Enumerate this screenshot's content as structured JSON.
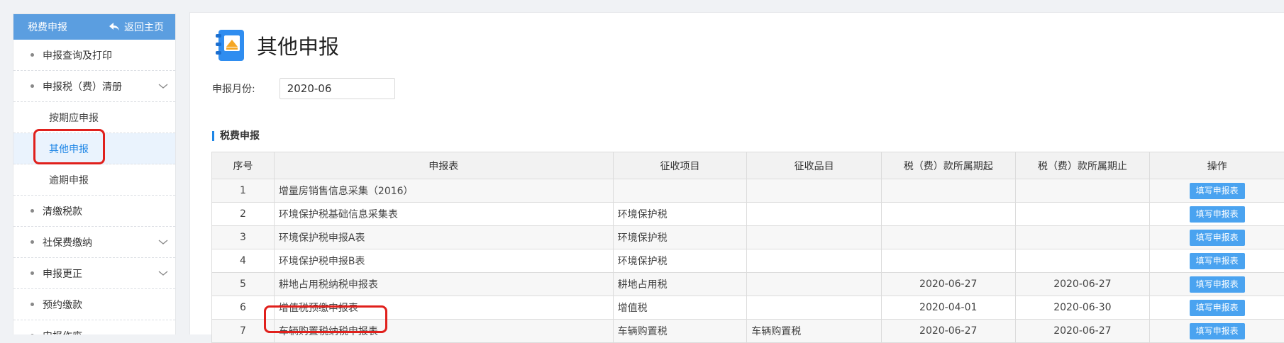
{
  "sidebar": {
    "header_title": "税费申报",
    "back_label": "返回主页",
    "items": [
      {
        "label": "申报查询及打印"
      },
      {
        "label": "申报税（费）清册"
      },
      {
        "label": "清缴税款"
      },
      {
        "label": "社保费缴纳"
      },
      {
        "label": "申报更正"
      },
      {
        "label": "预约缴款"
      },
      {
        "label": "申报作废"
      }
    ],
    "sub_items": [
      {
        "label": "按期应申报"
      },
      {
        "label": "其他申报"
      },
      {
        "label": "逾期申报"
      }
    ]
  },
  "main": {
    "title": "其他申报",
    "month_label": "申报月份:",
    "month_value": "2020-06",
    "section_title": "税费申报",
    "columns": [
      "序号",
      "申报表",
      "征收项目",
      "征收品目",
      "税（费）款所属期起",
      "税（费）款所属期止",
      "操作"
    ],
    "rows": [
      {
        "no": "1",
        "form": "增量房销售信息采集（2016）",
        "item": "",
        "sub": "",
        "start": "",
        "end": "",
        "action": "填写申报表"
      },
      {
        "no": "2",
        "form": "环境保护税基础信息采集表",
        "item": "环境保护税",
        "sub": "",
        "start": "",
        "end": "",
        "action": "填写申报表"
      },
      {
        "no": "3",
        "form": "环境保护税申报A表",
        "item": "环境保护税",
        "sub": "",
        "start": "",
        "end": "",
        "action": "填写申报表"
      },
      {
        "no": "4",
        "form": "环境保护税申报B表",
        "item": "环境保护税",
        "sub": "",
        "start": "",
        "end": "",
        "action": "填写申报表"
      },
      {
        "no": "5",
        "form": "耕地占用税纳税申报表",
        "item": "耕地占用税",
        "sub": "",
        "start": "2020-06-27",
        "end": "2020-06-27",
        "action": "填写申报表"
      },
      {
        "no": "6",
        "form": "增值税预缴申报表",
        "item": "增值税",
        "sub": "",
        "start": "2020-04-01",
        "end": "2020-06-30",
        "action": "填写申报表"
      },
      {
        "no": "7",
        "form": "车辆购置税纳税申报表",
        "item": "车辆购置税",
        "sub": "车辆购置税",
        "start": "2020-06-27",
        "end": "2020-06-27",
        "action": "填写申报表"
      }
    ]
  },
  "colors": {
    "header_blue": "#5b9ee0",
    "accent_blue": "#1e86e6",
    "button_blue": "#4aa3f0",
    "highlight_red": "#e0201c"
  }
}
